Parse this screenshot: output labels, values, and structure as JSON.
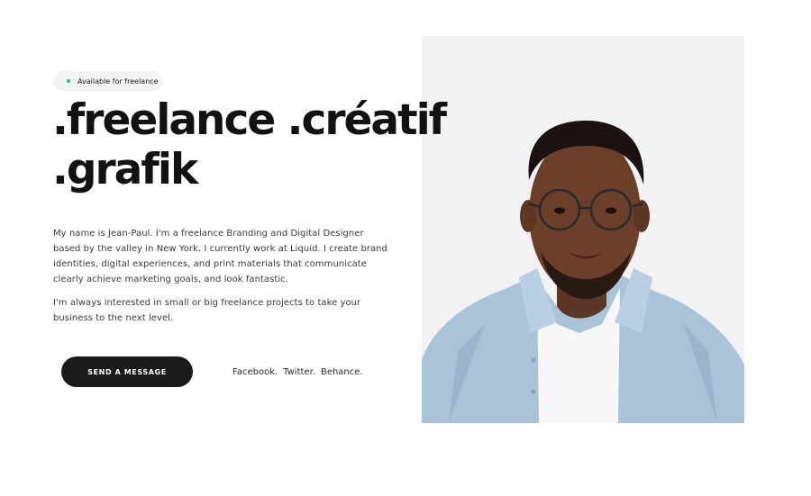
{
  "status": {
    "label": "Available for freelance",
    "dot_color": "#2fbf71"
  },
  "hero": {
    "line1": ".freelance .créatif",
    "line2": ".grafik"
  },
  "bio": {
    "paragraph1_lines": [
      "My name is Jean-Paul. I'm a freelance Branding and Digital Designer",
      "based by the valley in New York. I currently work at Liquid. I create brand",
      "identities, digital experiences, and print materials that communicate",
      "clearly achieve marketing goals, and look fantastic."
    ],
    "paragraph2_lines": [
      "I'm always interested in small or big freelance projects to take your",
      "business to the next level."
    ]
  },
  "cta": {
    "label": "SEND A MESSAGE"
  },
  "socials": [
    "Facebook.",
    "Twitter.",
    "Behance."
  ],
  "portrait": {
    "icon": "person-portrait",
    "background": "#f2f2f2"
  }
}
